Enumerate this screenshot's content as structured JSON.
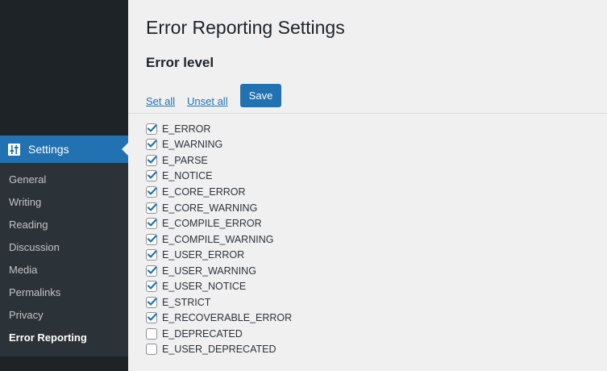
{
  "sidebar": {
    "settings_label": "Settings",
    "active_color": "#2271b1",
    "items": [
      {
        "label": "General",
        "current": false
      },
      {
        "label": "Writing",
        "current": false
      },
      {
        "label": "Reading",
        "current": false
      },
      {
        "label": "Discussion",
        "current": false
      },
      {
        "label": "Media",
        "current": false
      },
      {
        "label": "Permalinks",
        "current": false
      },
      {
        "label": "Privacy",
        "current": false
      },
      {
        "label": "Error Reporting",
        "current": true
      }
    ]
  },
  "page": {
    "title": "Error Reporting Settings",
    "section_title": "Error level",
    "set_all": "Set all",
    "unset_all": "Unset all",
    "save": "Save"
  },
  "levels": [
    {
      "name": "E_ERROR",
      "checked": true
    },
    {
      "name": "E_WARNING",
      "checked": true
    },
    {
      "name": "E_PARSE",
      "checked": true
    },
    {
      "name": "E_NOTICE",
      "checked": true
    },
    {
      "name": "E_CORE_ERROR",
      "checked": true
    },
    {
      "name": "E_CORE_WARNING",
      "checked": true
    },
    {
      "name": "E_COMPILE_ERROR",
      "checked": true
    },
    {
      "name": "E_COMPILE_WARNING",
      "checked": true
    },
    {
      "name": "E_USER_ERROR",
      "checked": true
    },
    {
      "name": "E_USER_WARNING",
      "checked": true
    },
    {
      "name": "E_USER_NOTICE",
      "checked": true
    },
    {
      "name": "E_STRICT",
      "checked": true
    },
    {
      "name": "E_RECOVERABLE_ERROR",
      "checked": true
    },
    {
      "name": "E_DEPRECATED",
      "checked": false
    },
    {
      "name": "E_USER_DEPRECATED",
      "checked": false
    }
  ]
}
